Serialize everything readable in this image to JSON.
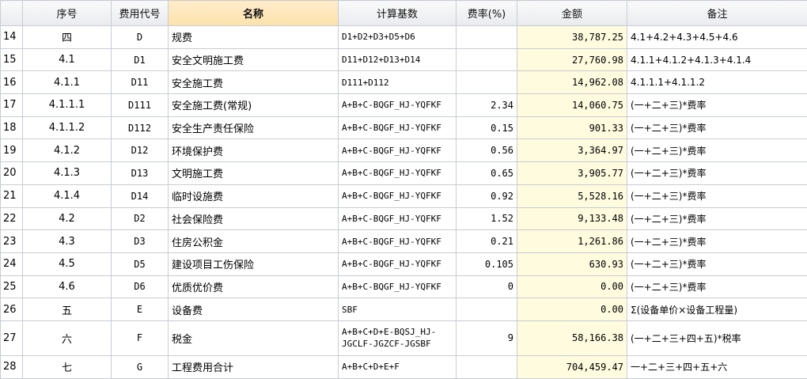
{
  "headers": {
    "seq": "序号",
    "code": "费用代号",
    "name": "名称",
    "basis": "计算基数",
    "rate": "费率(%)",
    "amount": "金额",
    "note": "备注"
  },
  "rows": [
    {
      "rn": "14",
      "seq": "四",
      "code": "D",
      "name": "规费",
      "basis": "D1+D2+D3+D5+D6",
      "rate": "",
      "amount": "38,787.25",
      "note": "4.1+4.2+4.3+4.5+4.6"
    },
    {
      "rn": "15",
      "seq": "4.1",
      "code": "D1",
      "name": "安全文明施工费",
      "basis": "D11+D12+D13+D14",
      "rate": "",
      "amount": "27,760.98",
      "note": "4.1.1+4.1.2+4.1.3+4.1.4"
    },
    {
      "rn": "16",
      "seq": "4.1.1",
      "code": "D11",
      "name": "安全施工费",
      "basis": "D111+D112",
      "rate": "",
      "amount": "14,962.08",
      "note": "4.1.1.1+4.1.1.2"
    },
    {
      "rn": "17",
      "seq": "4.1.1.1",
      "code": "D111",
      "name": "安全施工费(常规)",
      "basis": "A+B+C-BQGF_HJ-YQFKF",
      "rate": "2.34",
      "amount": "14,060.75",
      "note": "(一+二+三)*费率"
    },
    {
      "rn": "18",
      "seq": "4.1.1.2",
      "code": "D112",
      "name": "安全生产责任保险",
      "basis": "A+B+C-BQGF_HJ-YQFKF",
      "rate": "0.15",
      "amount": "901.33",
      "note": "(一+二+三)*费率"
    },
    {
      "rn": "19",
      "seq": "4.1.2",
      "code": "D12",
      "name": "环境保护费",
      "basis": "A+B+C-BQGF_HJ-YQFKF",
      "rate": "0.56",
      "amount": "3,364.97",
      "note": "(一+二+三)*费率"
    },
    {
      "rn": "20",
      "seq": "4.1.3",
      "code": "D13",
      "name": "文明施工费",
      "basis": "A+B+C-BQGF_HJ-YQFKF",
      "rate": "0.65",
      "amount": "3,905.77",
      "note": "(一+二+三)*费率"
    },
    {
      "rn": "21",
      "seq": "4.1.4",
      "code": "D14",
      "name": "临时设施费",
      "basis": "A+B+C-BQGF_HJ-YQFKF",
      "rate": "0.92",
      "amount": "5,528.16",
      "note": "(一+二+三)*费率"
    },
    {
      "rn": "22",
      "seq": "4.2",
      "code": "D2",
      "name": "社会保险费",
      "basis": "A+B+C-BQGF_HJ-YQFKF",
      "rate": "1.52",
      "amount": "9,133.48",
      "note": "(一+二+三)*费率"
    },
    {
      "rn": "23",
      "seq": "4.3",
      "code": "D3",
      "name": "住房公积金",
      "basis": "A+B+C-BQGF_HJ-YQFKF",
      "rate": "0.21",
      "amount": "1,261.86",
      "note": "(一+二+三)*费率"
    },
    {
      "rn": "24",
      "seq": "4.5",
      "code": "D5",
      "name": "建设项目工伤保险",
      "basis": "A+B+C-BQGF_HJ-YQFKF",
      "rate": "0.105",
      "amount": "630.93",
      "note": "(一+二+三)*费率"
    },
    {
      "rn": "25",
      "seq": "4.6",
      "code": "D6",
      "name": "优质优价费",
      "basis": "A+B+C-BQGF_HJ-YQFKF",
      "rate": "0",
      "amount": "0.00",
      "note": "(一+二+三)*费率"
    },
    {
      "rn": "26",
      "seq": "五",
      "code": "E",
      "name": "设备费",
      "basis": "SBF",
      "rate": "",
      "amount": "0.00",
      "note": "Σ(设备单价×设备工程量)"
    },
    {
      "rn": "27",
      "seq": "六",
      "code": "F",
      "name": "税金",
      "basis": "A+B+C+D+E-BQSJ_HJ-JGCLF-JGZCF-JGSBF",
      "rate": "9",
      "amount": "58,166.38",
      "note": "(一+二+三+四+五)*税率"
    },
    {
      "rn": "28",
      "seq": "七",
      "code": "G",
      "name": "工程费用合计",
      "basis": "A+B+C+D+E+F",
      "rate": "",
      "amount": "704,459.47",
      "note": "一+二+三+四+五+六"
    }
  ]
}
